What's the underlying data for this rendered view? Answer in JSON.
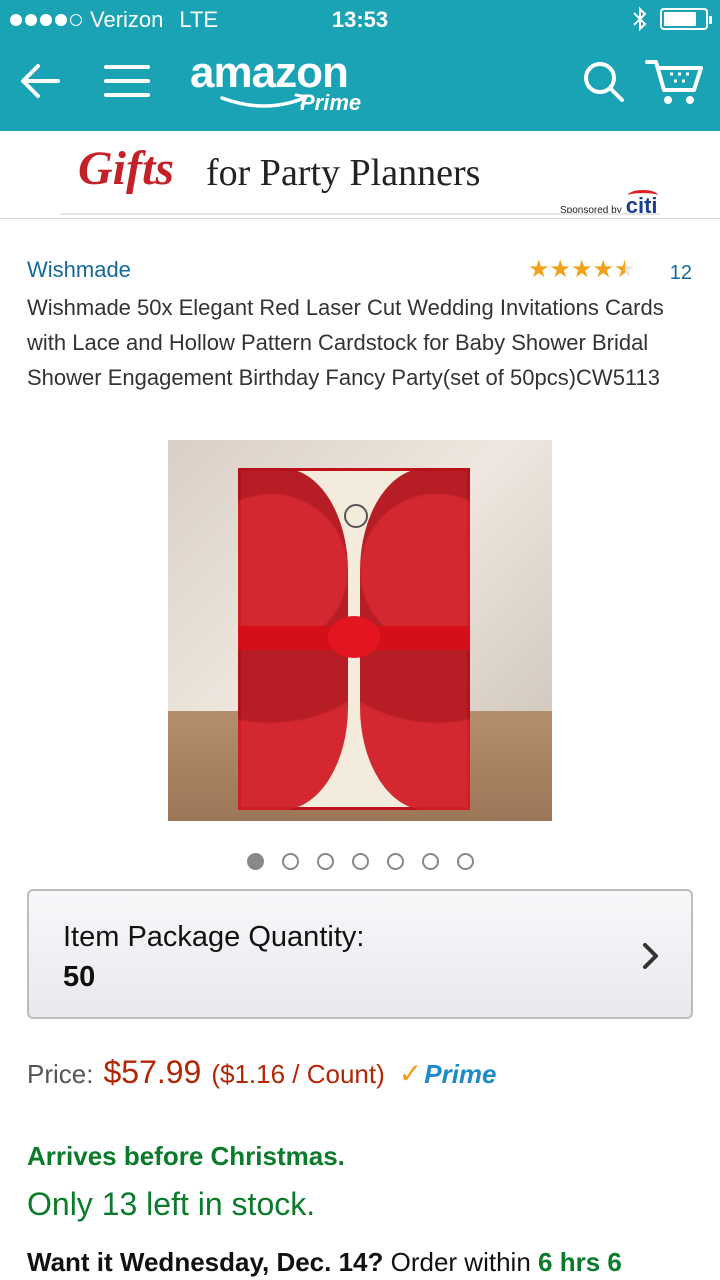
{
  "status_bar": {
    "carrier": "Verizon",
    "network": "LTE",
    "time": "13:53",
    "bluetooth_icon": "bluetooth-icon",
    "battery_icon": "battery-icon"
  },
  "header": {
    "logo_text": "amazon",
    "logo_sub": "Prime",
    "colors": {
      "bar": "#1aa2b5"
    }
  },
  "banner": {
    "gifts": "Gifts",
    "rest": "for Party Planners",
    "sponsored_by": "Sponsored by",
    "sponsor_name": "citi"
  },
  "product": {
    "brand": "Wishmade",
    "rating_value": 4.5,
    "rating_count": "12",
    "title": "Wishmade 50x Elegant Red Laser Cut Wedding Invitations Cards with Lace and Hollow Pattern Cardstock for Baby Shower Bridal Shower Engagement Birthday Fancy Party(set of 50pcs)CW5113",
    "image_pages": 7,
    "image_active_index": 0
  },
  "quantity": {
    "label": "Item Package Quantity:",
    "value": "50"
  },
  "price": {
    "label": "Price:",
    "value": "$57.99",
    "unit": "($1.16 / Count)",
    "prime": "Prime"
  },
  "delivery": {
    "arrives": "Arrives before Christmas.",
    "stock": "Only 13 left in stock.",
    "want_prefix": "Want it Wednesday, Dec. 14?",
    "order_within": "Order within",
    "countdown": "6 hrs 6"
  }
}
